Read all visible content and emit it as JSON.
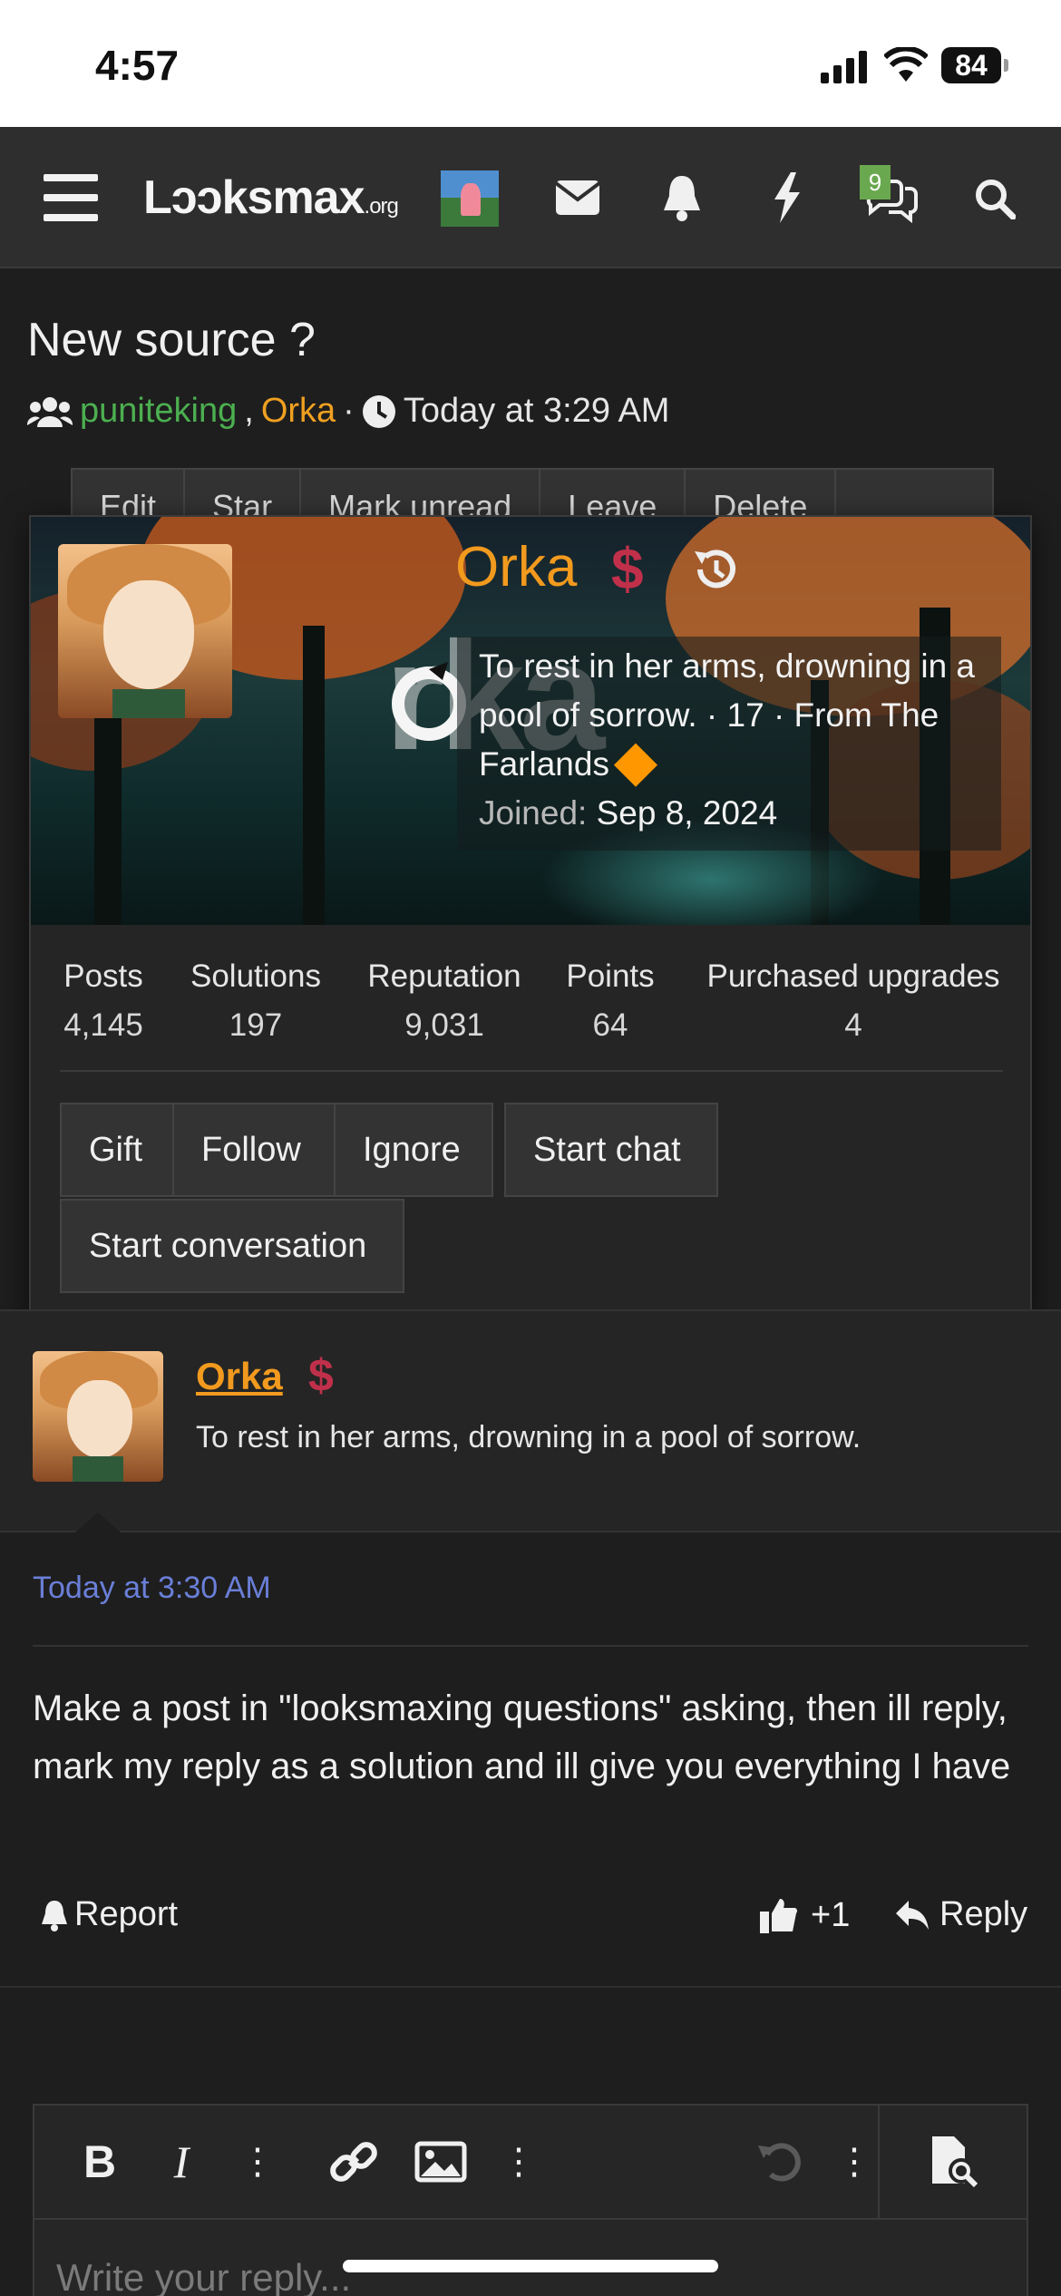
{
  "status": {
    "time": "4:57",
    "battery": "84"
  },
  "nav": {
    "logo_main": "Lɔɔksmax",
    "logo_suffix": ".org",
    "messages_badge": "9"
  },
  "thread": {
    "title": "New source ?",
    "participants": [
      "puniteking",
      "Orka"
    ],
    "separator": ",",
    "dot": "·",
    "time": "Today at 3:29 AM"
  },
  "actionbar": [
    "Edit",
    "Star",
    "Mark unread",
    "Leave",
    "Delete"
  ],
  "card": {
    "username": "Orka",
    "dollar": "$",
    "big_name": "rka",
    "bio_line": "To rest in her arms, drowning in a pool of sorrow. · 17 · From The Farlands",
    "joined_label": "Joined:",
    "joined_value": "Sep 8, 2024",
    "stats": [
      {
        "label": "Posts",
        "value": "4,145"
      },
      {
        "label": "Solutions",
        "value": "197"
      },
      {
        "label": "Reputation",
        "value": "9,031"
      },
      {
        "label": "Points",
        "value": "64"
      },
      {
        "label": "Purchased upgrades",
        "value": "4"
      }
    ],
    "buttons": {
      "gift": "Gift",
      "follow": "Follow",
      "ignore": "Ignore",
      "start_chat": "Start chat",
      "start_conversation": "Start conversation"
    }
  },
  "post": {
    "author": "Orka",
    "dollar": "$",
    "user_title": "To rest in her arms, drowning in a pool of sorrow.",
    "date": "Today at 3:30 AM",
    "body": "Make a post in \"looksmaxing questions\" asking, then ill reply, mark my reply as a solution and ill give you everything I have",
    "report": "Report",
    "likes": "+1",
    "reply": "Reply"
  },
  "editor": {
    "placeholder": "Write your reply..."
  },
  "colors": {
    "accent_orange": "#f29a1e",
    "green": "#4caf50",
    "link_blue": "#6a7fd8",
    "dollar_red": "#c0304a"
  }
}
